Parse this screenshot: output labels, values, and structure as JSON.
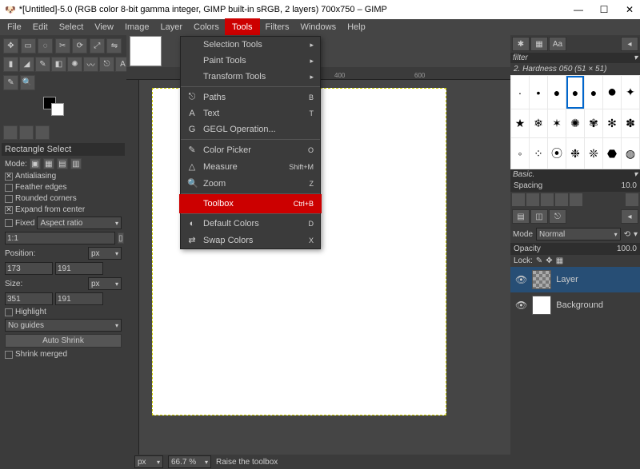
{
  "window": {
    "title": "*[Untitled]-5.0 (RGB color 8-bit gamma integer, GIMP built-in sRGB, 2 layers) 700x750 – GIMP",
    "min": "—",
    "max": "☐",
    "close": "✕"
  },
  "menubar": [
    "File",
    "Edit",
    "Select",
    "View",
    "Image",
    "Layer",
    "Colors",
    "Tools",
    "Filters",
    "Windows",
    "Help"
  ],
  "menubar_active_index": 7,
  "tools_menu": {
    "submenus": [
      {
        "label": "Selection Tools",
        "arrow": "▸"
      },
      {
        "label": "Paint Tools",
        "arrow": "▸"
      },
      {
        "label": "Transform Tools",
        "arrow": "▸"
      }
    ],
    "items1": [
      {
        "icon": "⎋",
        "label": "Paths",
        "shortcut": "B"
      },
      {
        "icon": "A",
        "label": "Text",
        "shortcut": "T"
      },
      {
        "icon": "G",
        "label": "GEGL Operation...",
        "shortcut": ""
      }
    ],
    "items2": [
      {
        "icon": "✎",
        "label": "Color Picker",
        "shortcut": "O"
      },
      {
        "icon": "△",
        "label": "Measure",
        "shortcut": "Shift+M"
      },
      {
        "icon": "🔍",
        "label": "Zoom",
        "shortcut": "Z"
      }
    ],
    "highlight": {
      "label": "Toolbox",
      "shortcut": "Ctrl+B"
    },
    "items3": [
      {
        "icon": "◐",
        "label": "Default Colors",
        "shortcut": "D"
      },
      {
        "icon": "⇄",
        "label": "Swap Colors",
        "shortcut": "X"
      }
    ]
  },
  "tool_options": {
    "header": "Rectangle Select",
    "mode_label": "Mode:",
    "antialiasing": "Antialiasing",
    "feather": "Feather edges",
    "rounded": "Rounded corners",
    "expand": "Expand from center",
    "fixed": "Fixed",
    "aspect_label": "Aspect ratio",
    "aspect_val": "1:1",
    "pos_label": "Position:",
    "pos_unit": "px",
    "pos_x": "173",
    "pos_y": "191",
    "size_label": "Size:",
    "size_unit": "px",
    "size_w": "351",
    "size_h": "191",
    "highlight": "Highlight",
    "guides": "No guides",
    "auto_shrink": "Auto Shrink",
    "shrink_merged": "Shrink merged"
  },
  "rulers_top": {
    "marks": [
      "400",
      "600"
    ]
  },
  "statusbar": {
    "unit": "px",
    "zoom": "66.7 %",
    "msg": "Raise the toolbox"
  },
  "right": {
    "filter": "filter",
    "brush_name": "2. Hardness 050 (51 × 51)",
    "basic": "Basic.",
    "spacing_label": "Spacing",
    "spacing_val": "10.0",
    "mode_label": "Mode",
    "mode_val": "Normal",
    "opacity_label": "Opacity",
    "opacity_val": "100.0",
    "lock_label": "Lock:",
    "layer1": "Layer",
    "layer2": "Background"
  }
}
